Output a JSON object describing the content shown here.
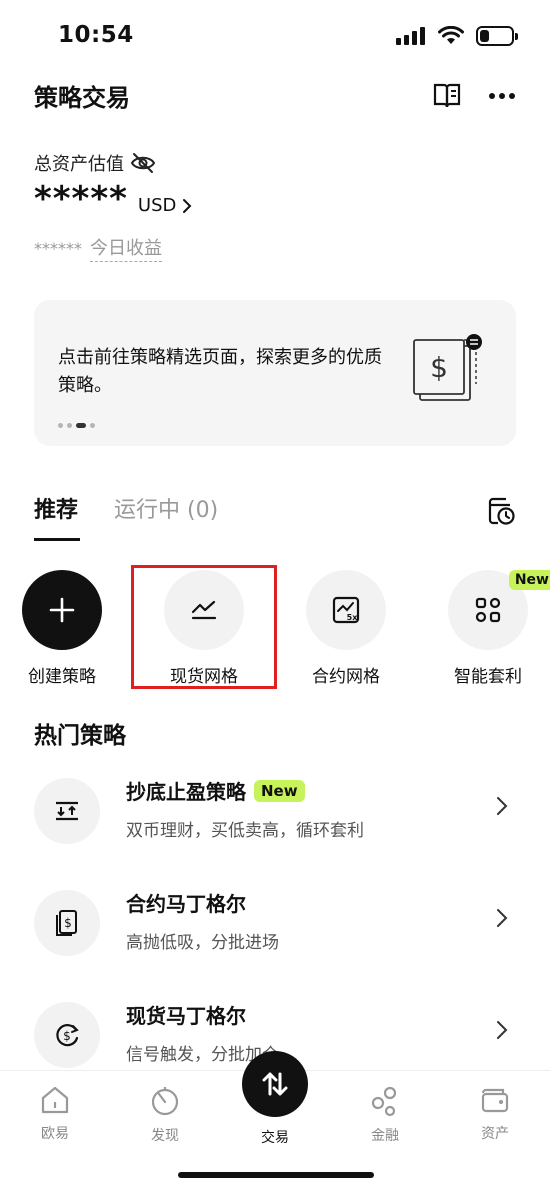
{
  "status": {
    "time": "10:54",
    "battery_level": 0.3
  },
  "header": {
    "title": "策略交易",
    "guide_icon": "book-icon",
    "more_icon": "more-icon"
  },
  "assets": {
    "label": "总资产估值",
    "hidden_value": "*****",
    "currency": "USD",
    "pnl_hidden": "******",
    "pnl_label": "今日收益"
  },
  "banner": {
    "text": "点击前往策略精选页面，探索更多的优质策略。"
  },
  "tabs": {
    "recommend": "推荐",
    "running": "运行中 (0)"
  },
  "quick_actions": [
    {
      "label": "创建策略",
      "icon": "plus-icon"
    },
    {
      "label": "现货网格",
      "icon": "spot-grid-icon"
    },
    {
      "label": "合约网格",
      "icon": "futures-grid-icon"
    },
    {
      "label": "智能套利",
      "icon": "arbitrage-icon",
      "badge": "New"
    }
  ],
  "hot": {
    "title": "热门策略",
    "items": [
      {
        "title": "抄底止盈策略",
        "badge": "New",
        "desc": "双币理财，买低卖高，循环套利"
      },
      {
        "title": "合约马丁格尔",
        "desc": "高抛低吸，分批进场"
      },
      {
        "title": "现货马丁格尔",
        "desc": "信号触发，分批加仓"
      }
    ]
  },
  "nav": [
    {
      "label": "欧易"
    },
    {
      "label": "发现"
    },
    {
      "label": "交易"
    },
    {
      "label": "金融"
    },
    {
      "label": "资产"
    }
  ],
  "colors": {
    "accent_green": "#c6f25a",
    "highlight_red": "#e02020"
  }
}
